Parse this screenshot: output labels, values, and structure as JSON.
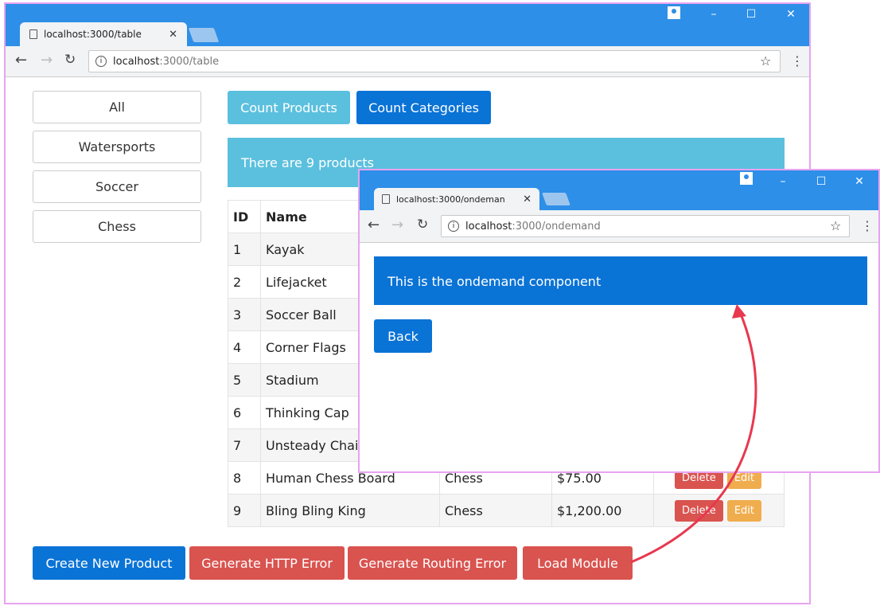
{
  "main_window": {
    "tab_title": "localhost:3000/table",
    "url_host": "localhost",
    "url_path": ":3000/table",
    "categories": [
      "All",
      "Watersports",
      "Soccer",
      "Chess"
    ],
    "count_products_label": "Count Products",
    "count_categories_label": "Count Categories",
    "message": "There are 9 products",
    "table": {
      "headers": [
        "ID",
        "Name"
      ],
      "rows": [
        {
          "id": "1",
          "name": "Kayak"
        },
        {
          "id": "2",
          "name": "Lifejacket"
        },
        {
          "id": "3",
          "name": "Soccer Ball"
        },
        {
          "id": "4",
          "name": "Corner Flags"
        },
        {
          "id": "5",
          "name": "Stadium"
        },
        {
          "id": "6",
          "name": "Thinking Cap"
        },
        {
          "id": "7",
          "name": "Unsteady Chair"
        },
        {
          "id": "8",
          "name": "Human Chess Board",
          "category": "Chess",
          "price": "$75.00"
        },
        {
          "id": "9",
          "name": "Bling Bling King",
          "category": "Chess",
          "price": "$1,200.00"
        }
      ],
      "delete_label": "Delete",
      "edit_label": "Edit"
    },
    "bottom_buttons": [
      "Create New Product",
      "Generate HTTP Error",
      "Generate Routing Error",
      "Load Module"
    ]
  },
  "popup_window": {
    "tab_title": "localhost:3000/ondeman",
    "url_host": "localhost",
    "url_path": ":3000/ondemand",
    "banner": "This is the ondemand component",
    "back_label": "Back"
  },
  "window_controls": {
    "minimize": "–",
    "maximize": "☐",
    "close": "✕"
  },
  "colors": {
    "primary": "#0a73d6",
    "info": "#5bc0de",
    "danger": "#d9534f",
    "warning": "#f0ad4e",
    "titlebar": "#2d8fe8",
    "annotation_arrow": "#e8384f"
  }
}
